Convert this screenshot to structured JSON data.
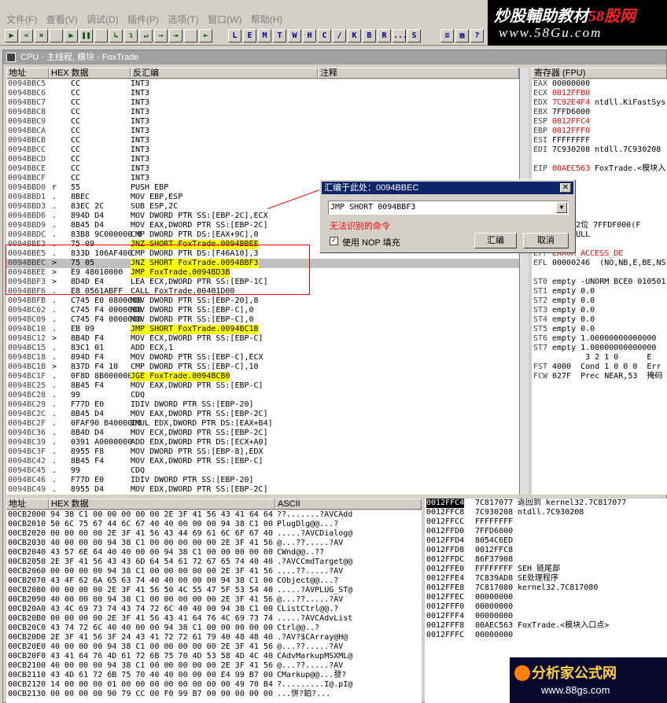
{
  "app": {
    "title": "CPU - 主线程, 模块 - FoxTrade"
  },
  "menu": [
    "文件(F)",
    "查看(V)",
    "调试(D)",
    "插件(P)",
    "选项(T)",
    "窗口(W)",
    "帮助(H)"
  ],
  "toolbar_letters": [
    "L",
    "E",
    "M",
    "T",
    "W",
    "H",
    "C",
    "/",
    "K",
    "B",
    "R",
    "...",
    "S"
  ],
  "logo": {
    "line1a": "炒股輔助教材",
    "line1b": "58股网",
    "line2": "www.58Gu.com"
  },
  "headers": {
    "addr": "地址",
    "hex": "HEX 数据",
    "disasm": "反汇编",
    "comment": "注释",
    "regs": "寄存器 (FPU)",
    "dump_addr": "地址",
    "dump_hex": "HEX 数据",
    "dump_ascii": "ASCII"
  },
  "disasm_rows": [
    [
      "0094BBC5",
      "",
      "CC",
      "INT3",
      "",
      ""
    ],
    [
      "0094BBC6",
      "",
      "CC",
      "INT3",
      "",
      ""
    ],
    [
      "0094BBC7",
      "",
      "CC",
      "INT3",
      "",
      ""
    ],
    [
      "0094BBC8",
      "",
      "CC",
      "INT3",
      "",
      ""
    ],
    [
      "0094BBC9",
      "",
      "CC",
      "INT3",
      "",
      ""
    ],
    [
      "0094BBCA",
      "",
      "CC",
      "INT3",
      "",
      ""
    ],
    [
      "0094BBCB",
      "",
      "CC",
      "INT3",
      "",
      ""
    ],
    [
      "0094BBCC",
      "",
      "CC",
      "INT3",
      "",
      ""
    ],
    [
      "0094BBCD",
      "",
      "CC",
      "INT3",
      "",
      ""
    ],
    [
      "0094BBCE",
      "",
      "CC",
      "INT3",
      "",
      ""
    ],
    [
      "0094BBCF",
      "",
      "CC",
      "INT3",
      "",
      ""
    ],
    [
      "0094BBD0",
      "r",
      "55",
      "PUSH EBP",
      "",
      ""
    ],
    [
      "0094BBD1",
      ".",
      "8BEC",
      "MOV EBP,ESP",
      "",
      ""
    ],
    [
      "0094BBD3",
      ".",
      "83EC 2C",
      "SUB ESP,2C",
      "",
      ""
    ],
    [
      "0094BBD6",
      ".",
      "894D D4",
      "MOV DWORD PTR SS:[EBP-2C],ECX",
      "c",
      ""
    ],
    [
      "0094BBD9",
      ".",
      "8B45 D4",
      "MOV EAX,DWORD PTR SS:[EBP-2C]",
      "c",
      ""
    ],
    [
      "0094BBDC",
      ".",
      "83B8 9C000000 0",
      "CMP DWORD PTR DS:[EAX+9C],0",
      "",
      ""
    ],
    [
      "0094BBE3",
      ".",
      "75 09",
      "JNZ SHORT FoxTrade.0094BBEE",
      "y",
      ""
    ],
    [
      "0094BBE5",
      ".",
      "833D 106AF400",
      "CMP DWORD PTR DS:[F46A10],3",
      "",
      ""
    ],
    [
      "0094BBEC",
      ">",
      "75 05",
      "JNZ SHORT FoxTrade.0094BBF3",
      "y",
      "s"
    ],
    [
      "0094BBEE",
      ">",
      "E9 48010000",
      "JMP FoxTrade.0094BD3B",
      "y",
      ""
    ],
    [
      "0094BBF3",
      ">",
      "8D4D E4",
      "LEA ECX,DWORD PTR SS:[EBP-1C]",
      "c",
      ""
    ],
    [
      "0094BBF6",
      ".",
      "E8 0561ABFF",
      "CALL FoxTrade.00401D00",
      "c",
      ""
    ],
    [
      "0094BBFB",
      ".",
      "C745 E0 0800000",
      "MOV DWORD PTR SS:[EBP-20],8",
      "c",
      ""
    ],
    [
      "0094BC02",
      ".",
      "C745 F4 0000000",
      "MOV DWORD PTR SS:[EBP-C],0",
      "c",
      ""
    ],
    [
      "0094BC09",
      ".",
      "C745 F4 0000000",
      "MOV DWORD PTR SS:[EBP-C],0",
      "c",
      ""
    ],
    [
      "0094BC10",
      ".",
      "EB 09",
      "JMP SHORT FoxTrade.0094BC1B",
      "y",
      ""
    ],
    [
      "0094BC12",
      ">",
      "8B4D F4",
      "MOV ECX,DWORD PTR SS:[EBP-C]",
      "c",
      ""
    ],
    [
      "0094BC15",
      ".",
      "83C1 01",
      "ADD ECX,1",
      "",
      ""
    ],
    [
      "0094BC18",
      ".",
      "894D F4",
      "MOV DWORD PTR SS:[EBP-C],ECX",
      "c",
      ""
    ],
    [
      "0094BC1B",
      ">",
      "837D F4 10",
      "CMP DWORD PTR SS:[EBP-C],10",
      "c",
      ""
    ],
    [
      "0094BC1F",
      ".",
      "0F8D 8B000000",
      "JGE FoxTrade.0094BCB0",
      "y",
      ""
    ],
    [
      "0094BC25",
      ".",
      "8B45 F4",
      "MOV EAX,DWORD PTR SS:[EBP-C]",
      "c",
      ""
    ],
    [
      "0094BC28",
      ".",
      "99",
      "CDQ",
      "",
      ""
    ],
    [
      "0094BC29",
      ".",
      "F77D E0",
      "IDIV DWORD PTR SS:[EBP-20]",
      "c",
      ""
    ],
    [
      "0094BC2C",
      ".",
      "8B45 D4",
      "MOV EAX,DWORD PTR SS:[EBP-2C]",
      "c",
      ""
    ],
    [
      "0094BC2F",
      ".",
      "0FAF90 B4000000",
      "IMUL EDX,DWORD PTR DS:[EAX+B4]",
      "",
      ""
    ],
    [
      "0094BC36",
      ".",
      "8B4D D4",
      "MOV ECX,DWORD PTR SS:[EBP-2C]",
      "c",
      ""
    ],
    [
      "0094BC39",
      ".",
      "0391 A0000000",
      "ADD EDX,DWORD PTR DS:[ECX+A0]",
      "",
      ""
    ],
    [
      "0094BC3F",
      ".",
      "8955 F8",
      "MOV DWORD PTR SS:[EBP-8],EDX",
      "c",
      ""
    ],
    [
      "0094BC42",
      ".",
      "8B45 F4",
      "MOV EAX,DWORD PTR SS:[EBP-C]",
      "c",
      ""
    ],
    [
      "0094BC45",
      ".",
      "99",
      "CDQ",
      "",
      ""
    ],
    [
      "0094BC46",
      ".",
      "F77D E0",
      "IDIV DWORD PTR SS:[EBP-20]",
      "c",
      ""
    ],
    [
      "0094BC49",
      ".",
      "8955 D4",
      "MOV EDX,DWORD PTR SS:[EBP-2C]",
      "c",
      ""
    ]
  ],
  "regs": [
    [
      "EAX",
      "00000000",
      ""
    ],
    [
      "ECX",
      "0012FFB0",
      ""
    ],
    [
      "EDX",
      "7C92E4F4",
      "ntdll.KiFastSys"
    ],
    [
      "EBX",
      "7FFD6000",
      ""
    ],
    [
      "ESP",
      "0012FFC4",
      ""
    ],
    [
      "EBP",
      "0012FFF0",
      ""
    ],
    [
      "ESI",
      "FFFFFFFF",
      ""
    ],
    [
      "EDI",
      "7C930208",
      "ntdll.7C930208"
    ],
    [
      "",
      "",
      " "
    ],
    [
      "EIP",
      "00AEC563",
      "FoxTrade.<模块入"
    ]
  ],
  "regs_lower": [
    [
      "",
      "3B  32位 7FFDF000(F"
    ],
    [
      "",
      "00  NULL"
    ],
    [
      "",
      "",
      ""
    ],
    [
      "Err",
      "ERROR_ACCESS_DE"
    ],
    [
      "EFL",
      "00000246  (NO,NB,E,BE,NS,"
    ],
    [
      "",
      "",
      ""
    ],
    [
      "ST0",
      "empty -UNORM BCE0 010501"
    ],
    [
      "ST1",
      "empty 0.0"
    ],
    [
      "ST2",
      "empty 0.0"
    ],
    [
      "ST3",
      "empty 0.0"
    ],
    [
      "ST4",
      "empty 0.0"
    ],
    [
      "ST5",
      "empty 0.0"
    ],
    [
      "ST6",
      "empty 1.00000000000000"
    ],
    [
      "ST7",
      "empty 1.00000000000000"
    ],
    [
      "",
      "       3 2 1 0      E"
    ],
    [
      "FST",
      "4000  Cond 1 0 0 0  Err"
    ],
    [
      "FCW",
      "027F  Prec NEAR,53  掩码"
    ]
  ],
  "dump_rows": [
    [
      "00CB2000",
      "94 38 C1 00 00 00 00 00 2E 3F 41 56 43 41 64 64",
      "??.......?AVCAdd"
    ],
    [
      "00CB2010",
      "50 6C 75 67 44 6C 67 40 40 00 00 00 94 38 C1 00",
      "PlugDlg@@...?"
    ],
    [
      "00CB2020",
      "00 00 00 00 2E 3F 41 56 43 44 69 61 6C 6F 67 40",
      ".....?AVCDialog@"
    ],
    [
      "00CB2030",
      "40 00 00 00 94 38 C1 00 00 00 00 00 2E 3F 41 56",
      "@...??.....?AV"
    ],
    [
      "00CB2040",
      "43 57 6E 64 40 40 00 00 94 38 C1 00 00 00 00 00",
      "CWnd@@..??"
    ],
    [
      "00CB2050",
      "2E 3F 41 56 43 43 6D 64 54 61 72 67 65 74 40 40",
      ".?AVCCmdTarget@@"
    ],
    [
      "00CB2060",
      "00 00 00 00 94 38 C1 00 00 00 00 00 2E 3F 41 56",
      "....??.....?AV"
    ],
    [
      "00CB2070",
      "43 4F 62 6A 65 63 74 40 40 00 00 00 94 38 C1 00",
      "CObject@@...?"
    ],
    [
      "00CB2080",
      "00 00 00 00 2E 3F 41 56 50 4C 55 47 5F 53 54 40",
      ".....?AVPLUG_ST@"
    ],
    [
      "00CB2090",
      "40 00 00 00 94 38 C1 00 00 00 00 00 2E 3F 41 56",
      "@...??.....?AV"
    ],
    [
      "00CB20A0",
      "43 4C 69 73 74 43 74 72 6C 40 40 00 94 38 C1 00",
      "CListCtrl@@.?"
    ],
    [
      "00CB20B0",
      "00 00 00 00 2E 3F 41 56 43 41 64 76 4C 69 73 74",
      ".....?AVCAdvList"
    ],
    [
      "00CB20C0",
      "43 74 72 6C 40 40 00 00 94 38 C1 00 00 00 00 00",
      "Ctrl@@..?"
    ],
    [
      "00CB20D0",
      "2E 3F 41 56 3F 24 43 41 72 72 61 79 40 48 48 40",
      ".?AV?$CArray@H@"
    ],
    [
      "00CB20E0",
      "40 00 00 00 94 38 C1 00 00 00 00 00 2E 3F 41 56",
      "@...??.....?AV"
    ],
    [
      "00CB20F0",
      "43 41 64 76 4D 61 72 6B 75 70 4D 53 58 4D 4C 40",
      "CAdvMarkupMSXML@"
    ],
    [
      "00CB2100",
      "40 00 00 00 94 38 C1 00 00 00 00 00 2E 3F 41 56",
      "@...??.....?AV"
    ],
    [
      "00CB2110",
      "43 4D 61 72 6B 75 70 40 40 00 00 00 E4 99 B7 00",
      "CMarkup@@...發?"
    ],
    [
      "00CB2120",
      "14 00 00 00 01 00 00 00 00 00 00 00 00 49 70 B4",
      "?.........I@.pI@"
    ],
    [
      "00CB2130",
      "00 00 00 00 90 79 CC 00 F0 99 B7 00 00 00 00 00",
      "...恲?鉑?..."
    ]
  ],
  "stack_rows": [
    [
      "0012FFC4",
      "7C817077",
      "返回到 kernel32.7C817077"
    ],
    [
      "0012FFC8",
      "7C930208",
      "ntdll.7C930208"
    ],
    [
      "0012FFCC",
      "FFFFFFFF",
      ""
    ],
    [
      "0012FFD0",
      "7FFD6000",
      ""
    ],
    [
      "0012FFD4",
      "8054C6ED",
      ""
    ],
    [
      "0012FFD8",
      "0012FFC8",
      ""
    ],
    [
      "0012FFDC",
      "86F37908",
      ""
    ],
    [
      "0012FFE0",
      "FFFFFFFF",
      "SEH 链尾部"
    ],
    [
      "0012FFE4",
      "7C839AD8",
      "SE处理程序"
    ],
    [
      "0012FFE8",
      "7C817080",
      "kernel32.7C817080"
    ],
    [
      "0012FFEC",
      "00000000",
      ""
    ],
    [
      "0012FFF0",
      "00000000",
      ""
    ],
    [
      "0012FFF4",
      "00000000",
      ""
    ],
    [
      "0012FFF8",
      "00AEC563",
      "FoxTrade.<模块入口点>"
    ],
    [
      "0012FFFC",
      "00000000",
      ""
    ]
  ],
  "dialog": {
    "title": "汇编于此处：0094BBEC",
    "combo": "JMP SHORT 0094BBF3",
    "error": "无法识别的命令",
    "checkbox_label": "使用 NOP 填充",
    "assemble": "汇编",
    "cancel": "取消"
  },
  "badge": {
    "line1": "分析家公式网",
    "line2": "www.88gs.com"
  },
  "colors": {
    "cyan": "#00ffff",
    "yellow": "#ffff00",
    "red": "#ff0000",
    "title_blue": "#0a246a"
  }
}
